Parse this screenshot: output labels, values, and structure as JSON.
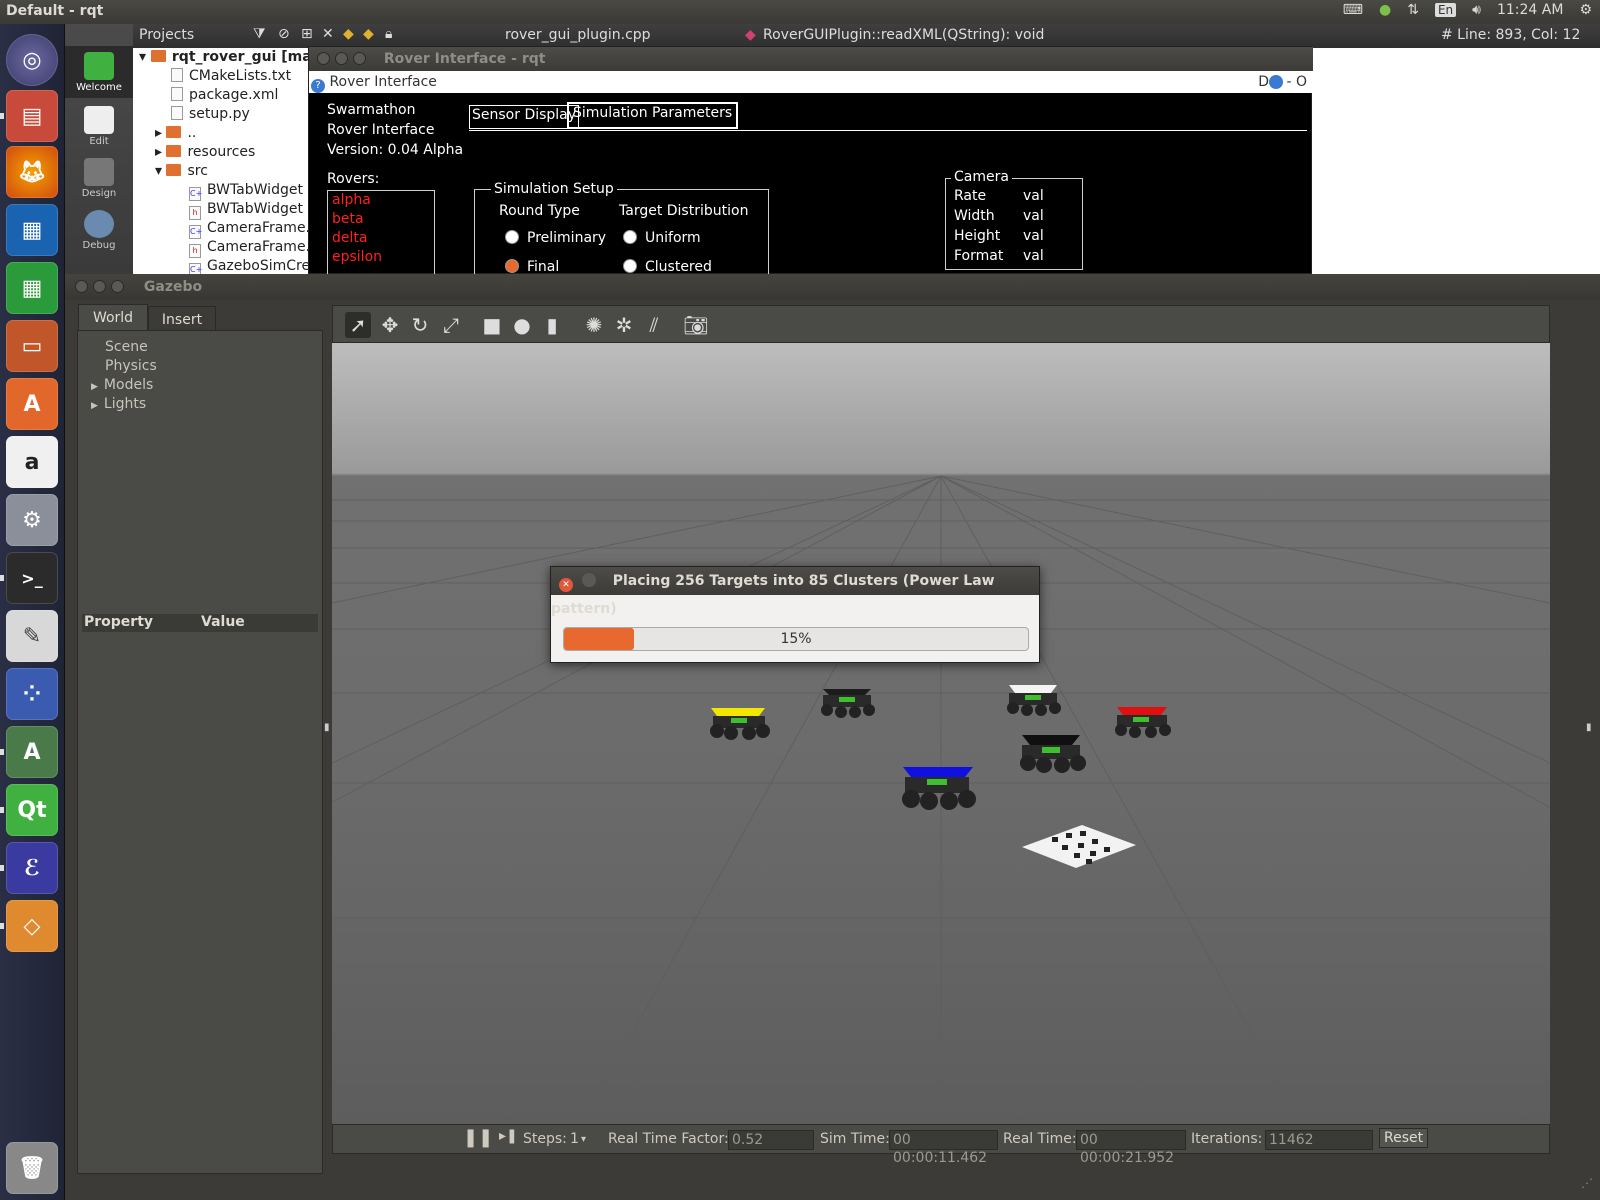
{
  "topbar": {
    "title": "Default - rqt",
    "lang": "En",
    "time": "11:24 AM"
  },
  "launcher": {
    "items": [
      "ubuntu-dash",
      "files",
      "firefox",
      "writer",
      "calc",
      "impress",
      "software-center",
      "amazon",
      "system-settings",
      "terminal",
      "text-editor",
      "app-grid",
      "software-updater",
      "qt-creator",
      "emacs",
      "package-installer"
    ]
  },
  "qtcreator": {
    "modes": [
      "Welcome",
      "Edit",
      "Design",
      "Debug"
    ],
    "projects_label": "Projects",
    "file_tab": "rover_gui_plugin.cpp",
    "function_tab": "RoverGUIPlugin::readXML(QString): void",
    "line_col": "# Line: 893, Col: 12",
    "tree": [
      {
        "label": "rqt_rover_gui [mat",
        "kind": "folder"
      },
      {
        "label": "CMakeLists.txt",
        "kind": "file"
      },
      {
        "label": "package.xml",
        "kind": "file"
      },
      {
        "label": "setup.py",
        "kind": "file"
      },
      {
        "label": "..",
        "kind": "folder"
      },
      {
        "label": "resources",
        "kind": "folder"
      },
      {
        "label": "src",
        "kind": "folder"
      },
      {
        "label": "BWTabWidget",
        "kind": "cpp"
      },
      {
        "label": "BWTabWidget",
        "kind": "h"
      },
      {
        "label": "CameraFrame.",
        "kind": "cpp"
      },
      {
        "label": "CameraFrame.",
        "kind": "h"
      },
      {
        "label": "GazeboSimCre",
        "kind": "cpp"
      }
    ]
  },
  "rqt": {
    "window_title": "Rover Interface - rqt",
    "plugin_title": "Rover Interface",
    "plugin_controls": "D",
    "plugin_controls_right": "- O",
    "app_name": "Swarmathon",
    "app_sub": "Rover Interface",
    "version": "Version:  0.04 Alpha",
    "tabs": [
      "Sensor Display",
      "Simulation Parameters"
    ],
    "rovers_label": "Rovers:",
    "rovers": [
      "alpha",
      "beta",
      "delta",
      "epsilon"
    ],
    "sim_setup": {
      "title": "Simulation Setup",
      "round_type": "Round Type",
      "target_dist": "Target Distribution",
      "preliminary": "Preliminary",
      "final": "Final",
      "uniform": "Uniform",
      "clustered": "Clustered"
    },
    "camera": {
      "title": "Camera",
      "rows": [
        [
          "Rate",
          "val"
        ],
        [
          "Width",
          "val"
        ],
        [
          "Height",
          "val"
        ],
        [
          "Format",
          "val"
        ]
      ]
    },
    "colors": {
      "rover_name": "#ff2020"
    }
  },
  "gazebo": {
    "window_title": "Gazebo",
    "tabs": [
      "World",
      "Insert"
    ],
    "world_items": [
      "Scene",
      "Physics",
      "Models",
      "Lights"
    ],
    "property_header": [
      "Property",
      "Value"
    ],
    "toolbar_icons": [
      "select-arrow-icon",
      "translate-icon",
      "rotate-icon",
      "scale-icon",
      "box-icon",
      "sphere-icon",
      "cylinder-icon",
      "point-light-icon",
      "spot-light-icon",
      "directional-light-icon",
      "screenshot-icon"
    ],
    "bottom": {
      "steps_label": "Steps:",
      "steps": "1",
      "rtf_label": "Real Time Factor:",
      "rtf": "0.52",
      "sim_label": "Sim Time:",
      "sim": "00 00:00:11.462",
      "real_label": "Real Time:",
      "real": "00 00:00:21.952",
      "iter_label": "Iterations:",
      "iter": "11462",
      "reset": "Reset"
    },
    "rovers": [
      {
        "color": "#f2e600"
      },
      {
        "color": "#1c1c1c"
      },
      {
        "color": "#f4f4f4"
      },
      {
        "color": "#e01010"
      },
      {
        "color": "#101010"
      },
      {
        "color": "#1010e0"
      }
    ]
  },
  "dialog": {
    "title": "Placing 256 Targets into 85 Clusters (Power Law pattern)",
    "progress_percent": 15,
    "progress_text": "15%",
    "accent": "#e8692f"
  }
}
